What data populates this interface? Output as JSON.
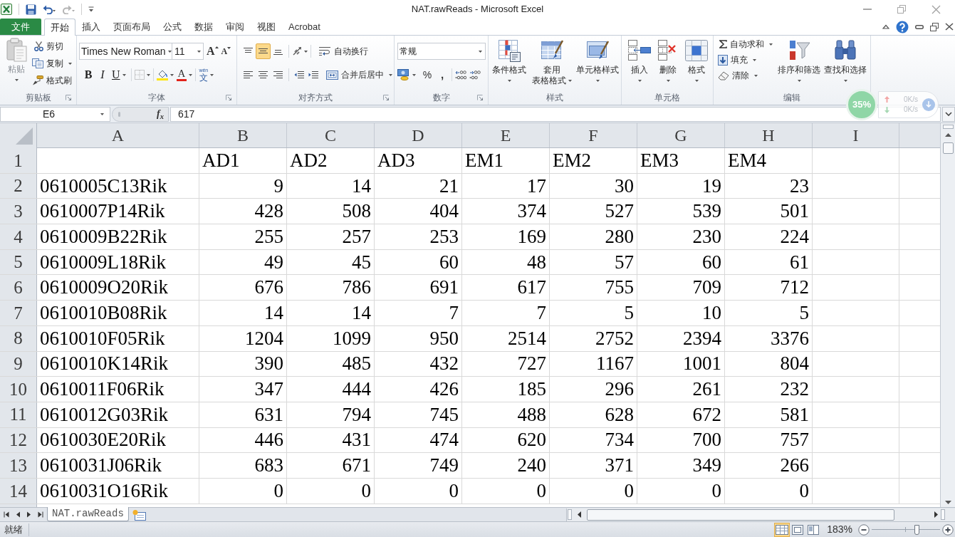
{
  "window": {
    "title": "NAT.rawReads - Microsoft Excel"
  },
  "ribbon_tabs": [
    {
      "label": "文件",
      "kind": "file",
      "selected": false
    },
    {
      "label": "开始",
      "kind": "tab",
      "selected": true
    },
    {
      "label": "插入",
      "kind": "tab",
      "selected": false
    },
    {
      "label": "页面布局",
      "kind": "tab",
      "selected": false
    },
    {
      "label": "公式",
      "kind": "tab",
      "selected": false
    },
    {
      "label": "数据",
      "kind": "tab",
      "selected": false
    },
    {
      "label": "审阅",
      "kind": "tab",
      "selected": false
    },
    {
      "label": "视图",
      "kind": "tab",
      "selected": false
    },
    {
      "label": "Acrobat",
      "kind": "tab",
      "selected": false
    }
  ],
  "ribbon_groups": [
    {
      "kind": "clipboard",
      "label": "剪贴板",
      "paste": "粘贴",
      "cut": "剪切",
      "copy": "复制",
      "format_painter": "格式刷"
    },
    {
      "kind": "font",
      "label": "字体",
      "font_name": "Times New Roman",
      "font_size": "11",
      "grow_font": "A",
      "shrink_font": "A",
      "bold": "B",
      "italic": "I",
      "underline": "U",
      "font_color": "A",
      "phonetic_reading": "wén",
      "phonetic_char": "文"
    },
    {
      "kind": "alignment",
      "label": "对齐方式",
      "vertical_align": [
        {
          "selected": false
        },
        {
          "selected": true
        },
        {
          "selected": false
        }
      ],
      "wrap_text": "自动换行",
      "merge_center": "合并后居中"
    },
    {
      "kind": "number",
      "label": "数字",
      "format": "常规",
      "percent": "%",
      "comma": ","
    },
    {
      "kind": "styles",
      "label": "样式",
      "conditional_formatting": "条件格式",
      "format_as_table": [
        "套用",
        "表格格式"
      ],
      "cell_styles": "单元格样式"
    },
    {
      "kind": "cells",
      "label": "单元格",
      "insert": "插入",
      "delete": "删除",
      "format": "格式"
    },
    {
      "kind": "editing",
      "label": "编辑",
      "autosum": "自动求和",
      "fill": "填充",
      "clear": "清除",
      "sort_filter": "排序和筛选",
      "find_select": "查找和选择"
    }
  ],
  "formula_bar": {
    "name_box": "E6",
    "fx_label": "f$_{x}$",
    "formula": "617"
  },
  "speed_widget": {
    "usage": "35%",
    "upload": "0K/s",
    "download": "0K/s"
  },
  "sheet": {
    "column_headers": [
      "A",
      "B",
      "C",
      "D",
      "E",
      "F",
      "G",
      "H",
      "I"
    ],
    "rows": [
      {
        "number": "1",
        "kind": "header",
        "values": [
          "AD1",
          "AD2",
          "AD3",
          "EM1",
          "EM2",
          "EM3",
          "EM4"
        ]
      },
      {
        "number": "2",
        "kind": "data",
        "name": "0610005C13Rik",
        "values": [
          "9",
          "14",
          "21",
          "17",
          "30",
          "19",
          "23"
        ]
      },
      {
        "number": "3",
        "kind": "data",
        "name": "0610007P14Rik",
        "values": [
          "428",
          "508",
          "404",
          "374",
          "527",
          "539",
          "501"
        ]
      },
      {
        "number": "4",
        "kind": "data",
        "name": "0610009B22Rik",
        "values": [
          "255",
          "257",
          "253",
          "169",
          "280",
          "230",
          "224"
        ]
      },
      {
        "number": "5",
        "kind": "data",
        "name": "0610009L18Rik",
        "values": [
          "49",
          "45",
          "60",
          "48",
          "57",
          "60",
          "61"
        ]
      },
      {
        "number": "6",
        "kind": "data",
        "name": "0610009O20Rik",
        "values": [
          "676",
          "786",
          "691",
          "617",
          "755",
          "709",
          "712"
        ]
      },
      {
        "number": "7",
        "kind": "data",
        "name": "0610010B08Rik",
        "values": [
          "14",
          "14",
          "7",
          "7",
          "5",
          "10",
          "5"
        ]
      },
      {
        "number": "8",
        "kind": "data",
        "name": "0610010F05Rik",
        "values": [
          "1204",
          "1099",
          "950",
          "2514",
          "2752",
          "2394",
          "3376"
        ]
      },
      {
        "number": "9",
        "kind": "data",
        "name": "0610010K14Rik",
        "values": [
          "390",
          "485",
          "432",
          "727",
          "1167",
          "1001",
          "804"
        ]
      },
      {
        "number": "10",
        "kind": "data",
        "name": "0610011F06Rik",
        "values": [
          "347",
          "444",
          "426",
          "185",
          "296",
          "261",
          "232"
        ]
      },
      {
        "number": "11",
        "kind": "data",
        "name": "0610012G03Rik",
        "values": [
          "631",
          "794",
          "745",
          "488",
          "628",
          "672",
          "581"
        ]
      },
      {
        "number": "12",
        "kind": "data",
        "name": "0610030E20Rik",
        "values": [
          "446",
          "431",
          "474",
          "620",
          "734",
          "700",
          "757"
        ]
      },
      {
        "number": "13",
        "kind": "data",
        "name": "0610031J06Rik",
        "values": [
          "683",
          "671",
          "749",
          "240",
          "371",
          "349",
          "266"
        ]
      },
      {
        "number": "14",
        "kind": "data",
        "name": "0610031O16Rik",
        "values": [
          "0",
          "0",
          "0",
          "0",
          "0",
          "0",
          "0"
        ]
      }
    ]
  },
  "sheet_tabs": [
    {
      "label": "NAT.rawReads",
      "selected": true
    }
  ],
  "status_bar": {
    "status": "就绪",
    "views": [
      {
        "selected": true
      },
      {
        "selected": false
      },
      {
        "selected": false
      }
    ],
    "zoom_label": "183%",
    "zoom_slider": {
      "level": 0.66
    }
  }
}
